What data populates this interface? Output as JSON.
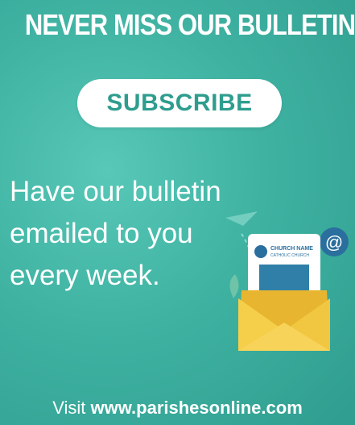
{
  "headline": "NEVER MISS OUR BULLETIN!",
  "subscribe_label": "SUBSCRIBE",
  "body_lines": [
    "Have our bulletin",
    "emailed to you",
    "every week."
  ],
  "illustration": {
    "card_line1": "CHURCH NAME",
    "card_line2": "CATHOLIC CHURCH",
    "at_symbol": "@",
    "icon": "envelope-bulletin-icon"
  },
  "footer": {
    "visit": "Visit",
    "url": "www.parishesonline.com"
  },
  "colors": {
    "background": "#3fb2a2",
    "button_text": "#2e9d8e",
    "envelope": "#f0c23a",
    "card_blue": "#2a6f9e"
  }
}
